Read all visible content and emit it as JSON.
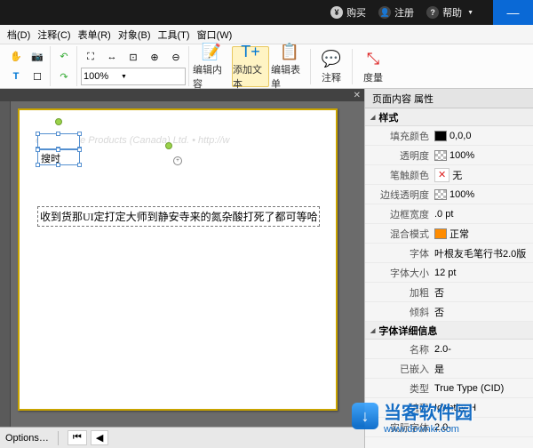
{
  "topbar": {
    "buy": "购买",
    "register": "注册",
    "help": "帮助"
  },
  "menu": {
    "items": [
      "档(D)",
      "注释(C)",
      "表单(R)",
      "对象(B)",
      "工具(T)",
      "窗口(W)"
    ]
  },
  "toolbar": {
    "zoom_value": "100%",
    "edit_content": "编辑内容",
    "add_text": "添加文本",
    "edit_form": "编辑表单",
    "comment": "注释",
    "measure": "度量"
  },
  "canvas": {
    "watermark": "er Software Products (Canada) Ltd. • http://w",
    "box1_text": "",
    "box2_text": "搜时",
    "brush_text": "收到货那UI定打定大师到静安寺来的氮杂酸打死了都可等哈",
    "options": "Options…"
  },
  "props": {
    "title": "页面内容 属性",
    "section_style": "样式",
    "fill_color_lbl": "填充颜色",
    "fill_color_val": "0,0,0",
    "opacity_lbl": "透明度",
    "opacity_val": "100%",
    "stroke_color_lbl": "笔触颜色",
    "stroke_color_val": "无",
    "stroke_opacity_lbl": "边线透明度",
    "stroke_opacity_val": "100%",
    "border_w_lbl": "边框宽度",
    "border_w_val": ".0 pt",
    "blend_lbl": "混合模式",
    "blend_val": "正常",
    "font_lbl": "字体",
    "font_val": "叶根友毛笔行书2.0版",
    "font_size_lbl": "字体大小",
    "font_size_val": "12 pt",
    "bold_lbl": "加粗",
    "bold_val": "否",
    "italic_lbl": "倾斜",
    "italic_val": "否",
    "section_detail": "字体详细信息",
    "name_lbl": "名称",
    "name_val": "2.0-",
    "embed_lbl": "已嵌入",
    "embed_val": "是",
    "type_lbl": "类型",
    "type_val": "True Type (CID)",
    "encode_lbl": "编码",
    "encode_val": "Identity-H",
    "actual_lbl": "实际字体",
    "actual_val": "2.0-"
  },
  "watermark_site": {
    "name": "当客软件园",
    "url": "www.downkr.com"
  }
}
